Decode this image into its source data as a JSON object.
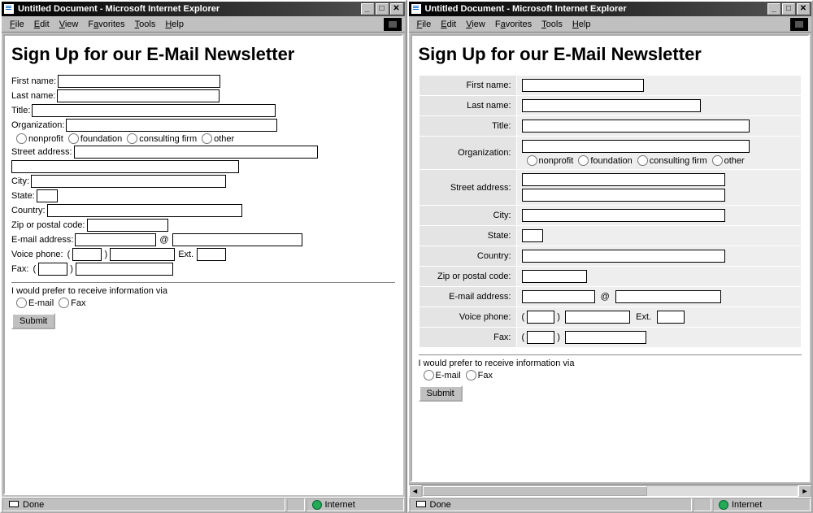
{
  "left": {
    "window_title": "Untitled Document - Microsoft Internet Explorer",
    "menu": [
      "File",
      "Edit",
      "View",
      "Favorites",
      "Tools",
      "Help"
    ],
    "heading": "Sign Up for our E-Mail Newsletter",
    "labels": {
      "first_name": "First name:",
      "last_name": "Last name:",
      "title": "Title:",
      "organization": "Organization:",
      "street": "Street address:",
      "city": "City:",
      "state": "State:",
      "country": "Country:",
      "zip": "Zip or postal code:",
      "email": "E-mail address:",
      "at": "@",
      "voice": "Voice phone:",
      "ext": "Ext.",
      "fax": "Fax:",
      "prefer": "I would prefer to receive information via",
      "pref_email": "E-mail",
      "pref_fax": "Fax"
    },
    "org_types": [
      "nonprofit",
      "foundation",
      "consulting firm",
      "other"
    ],
    "submit": "Submit",
    "status_left": "Done",
    "status_right": "Internet"
  },
  "right": {
    "window_title": "Untitled Document - Microsoft Internet Explorer",
    "menu": [
      "File",
      "Edit",
      "View",
      "Favorites",
      "Tools",
      "Help"
    ],
    "heading": "Sign Up for our E-Mail Newsletter",
    "labels": {
      "first_name": "First name:",
      "last_name": "Last name:",
      "title": "Title:",
      "organization": "Organization:",
      "street": "Street address:",
      "city": "City:",
      "state": "State:",
      "country": "Country:",
      "zip": "Zip or postal code:",
      "email": "E-mail address:",
      "at": "@",
      "voice": "Voice phone:",
      "ext": "Ext.",
      "fax": "Fax:",
      "prefer": "I would prefer to receive information via",
      "pref_email": "E-mail",
      "pref_fax": "Fax"
    },
    "org_types": [
      "nonprofit",
      "foundation",
      "consulting firm",
      "other"
    ],
    "submit": "Submit",
    "status_left": "Done",
    "status_right": "Internet"
  }
}
